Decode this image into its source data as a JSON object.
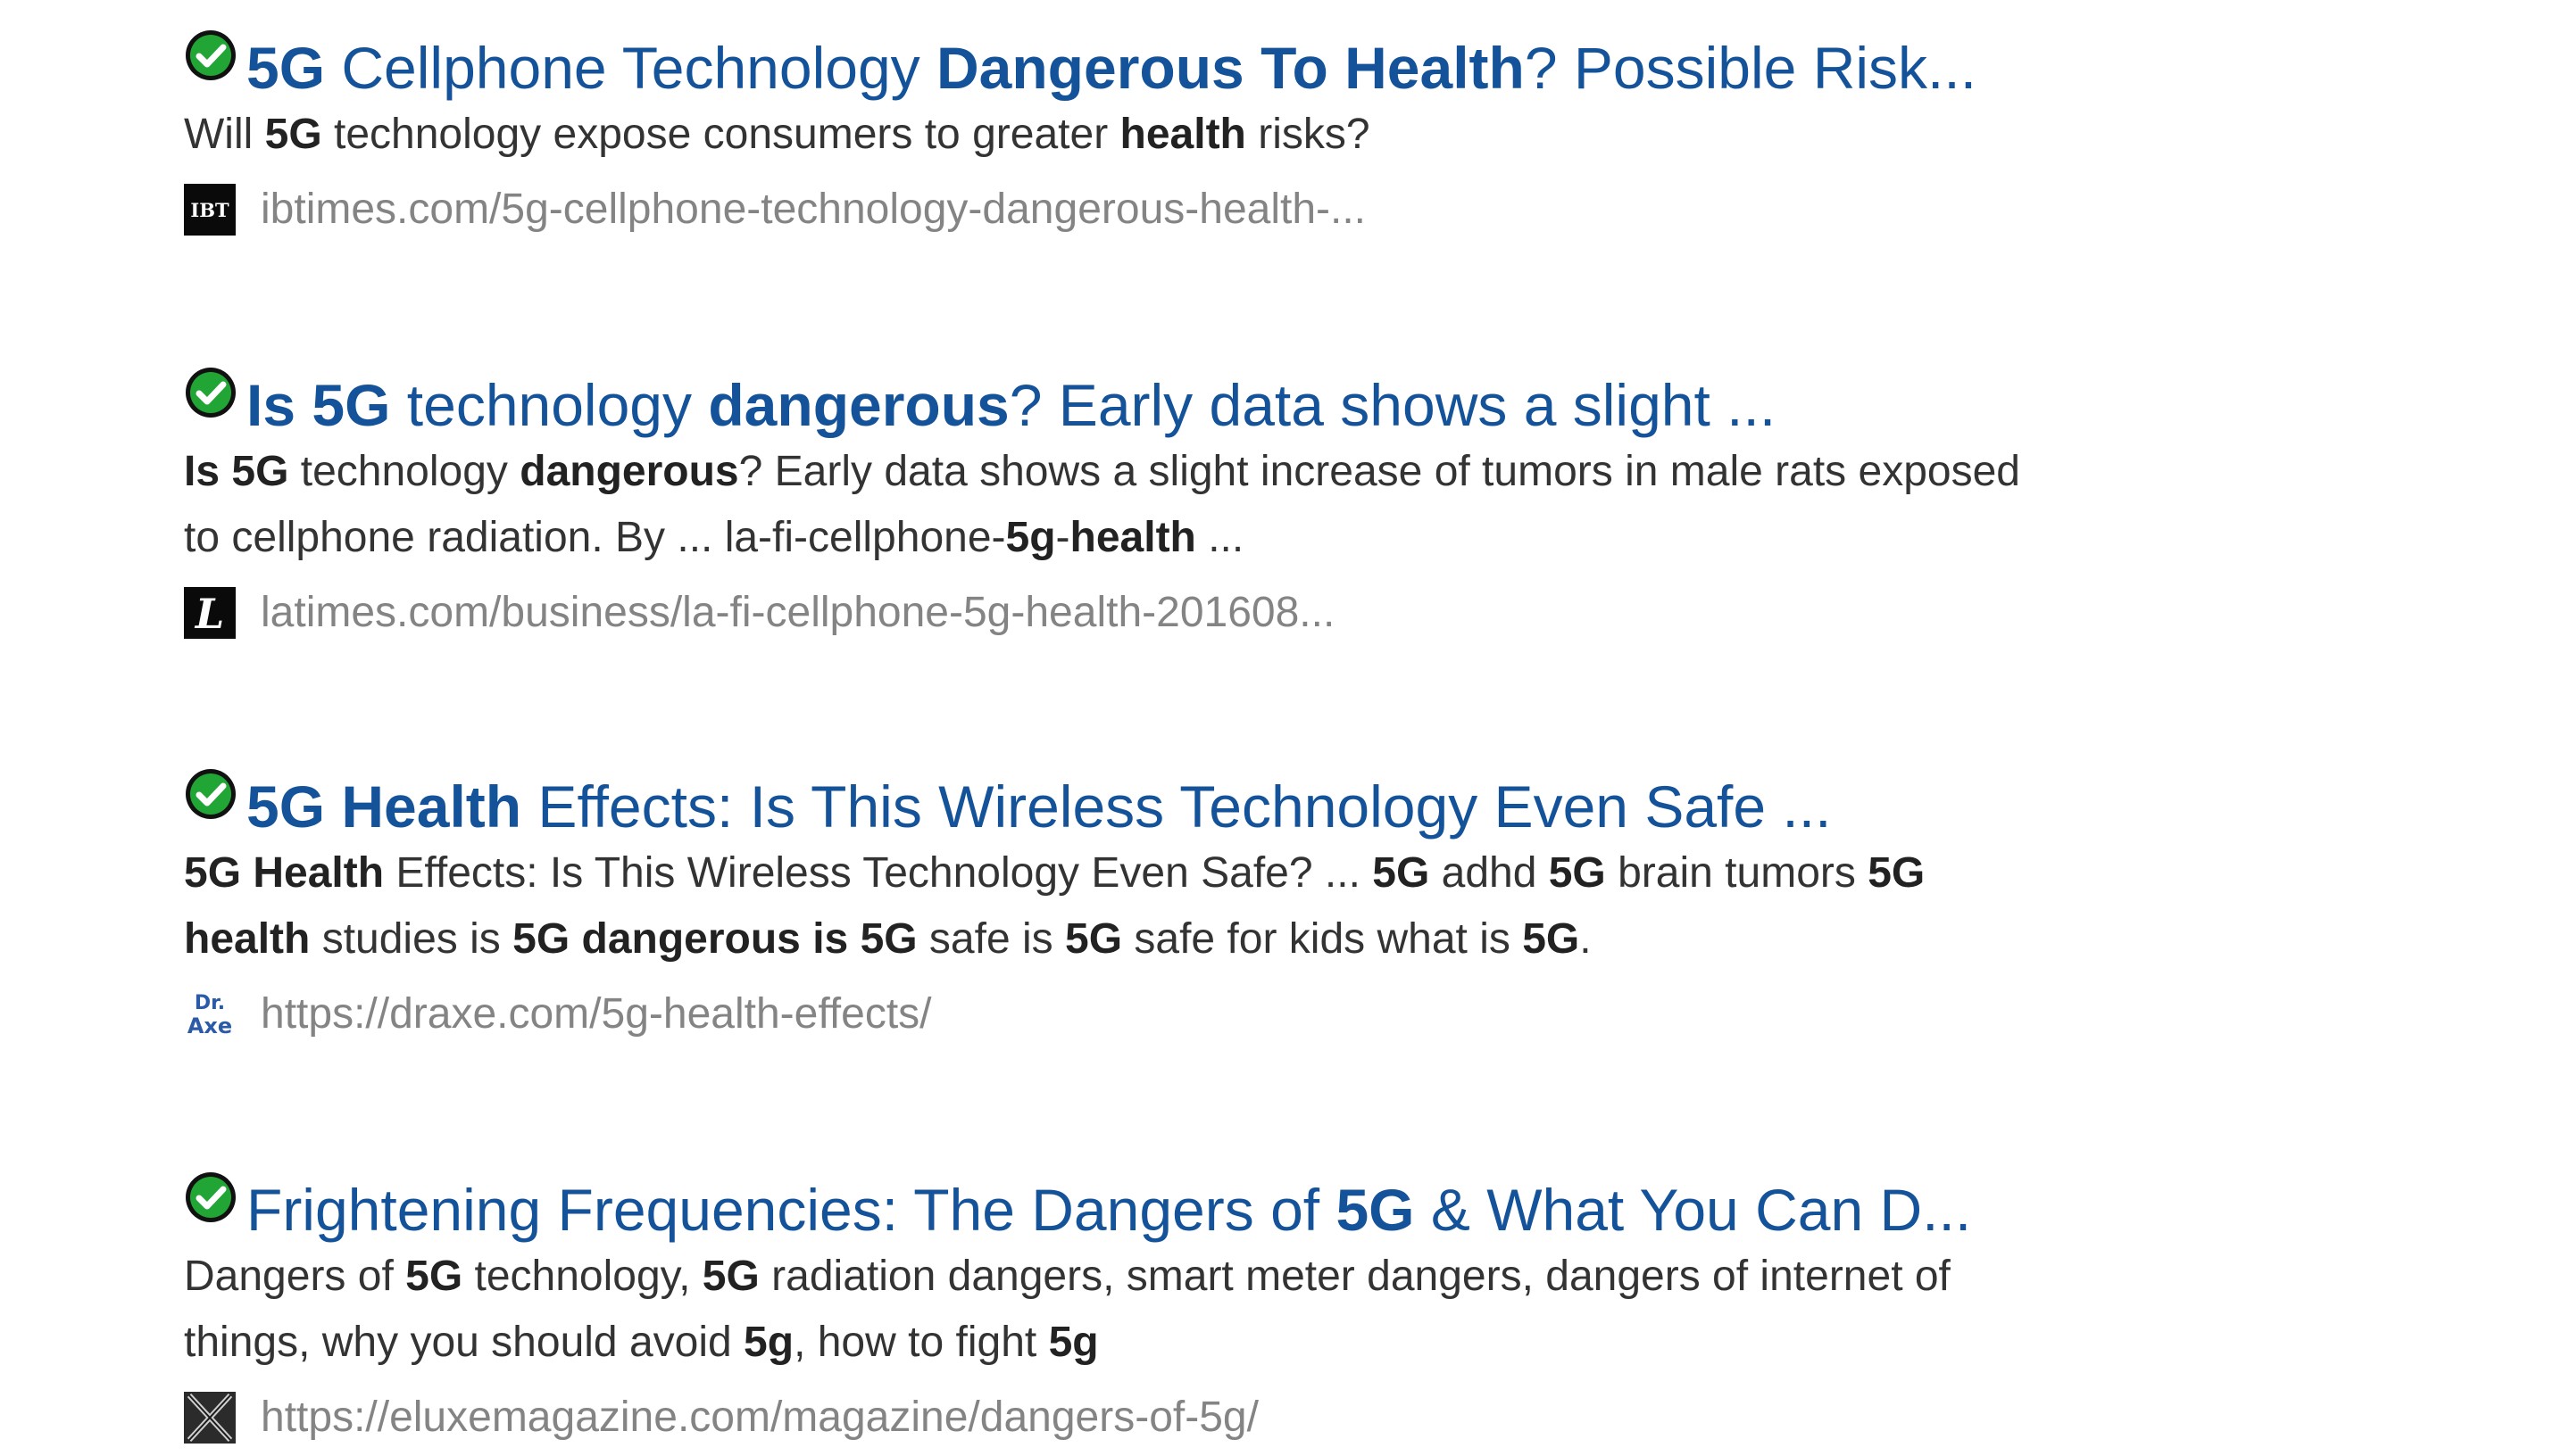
{
  "results": [
    {
      "title": [
        {
          "text": "5G",
          "bold": true
        },
        {
          "text": " Cellphone Technology ",
          "bold": false
        },
        {
          "text": "Dangerous To Health",
          "bold": true
        },
        {
          "text": "? Possible Risk...",
          "bold": false
        }
      ],
      "snippet": [
        {
          "text": "Will ",
          "bold": false
        },
        {
          "text": "5G",
          "bold": true
        },
        {
          "text": " technology expose consumers to greater ",
          "bold": false
        },
        {
          "text": "health",
          "bold": true
        },
        {
          "text": " risks?",
          "bold": false
        }
      ],
      "url": "ibtimes.com/5g-cellphone-technology-dangerous-health-...",
      "favicon_icon": "ibt-favicon-icon",
      "favicon_text": "IBT"
    },
    {
      "title": [
        {
          "text": "Is 5G",
          "bold": true
        },
        {
          "text": " technology ",
          "bold": false
        },
        {
          "text": "dangerous",
          "bold": true
        },
        {
          "text": "? Early data shows a slight ...",
          "bold": false
        }
      ],
      "snippet": [
        {
          "text": "Is 5G",
          "bold": true
        },
        {
          "text": " technology ",
          "bold": false
        },
        {
          "text": "dangerous",
          "bold": true
        },
        {
          "text": "? Early data shows a slight increase of tumors in male rats exposed to cellphone radiation. By ... la-fi-cellphone-",
          "bold": false
        },
        {
          "text": "5g",
          "bold": true
        },
        {
          "text": "-",
          "bold": false
        },
        {
          "text": "health",
          "bold": true
        },
        {
          "text": " ...",
          "bold": false
        }
      ],
      "url": "latimes.com/business/la-fi-cellphone-5g-health-201608...",
      "favicon_icon": "latimes-favicon-icon",
      "favicon_text": "L"
    },
    {
      "title": [
        {
          "text": "5G Health",
          "bold": true
        },
        {
          "text": " Effects: Is This Wireless Technology Even Safe ...",
          "bold": false
        }
      ],
      "snippet": [
        {
          "text": "5G Health",
          "bold": true
        },
        {
          "text": " Effects: Is This Wireless Technology Even Safe? ... ",
          "bold": false
        },
        {
          "text": "5G",
          "bold": true
        },
        {
          "text": " adhd ",
          "bold": false
        },
        {
          "text": "5G",
          "bold": true
        },
        {
          "text": " brain tumors ",
          "bold": false
        },
        {
          "text": "5G health",
          "bold": true
        },
        {
          "text": " studies is ",
          "bold": false
        },
        {
          "text": "5G dangerous is 5G",
          "bold": true
        },
        {
          "text": " safe is ",
          "bold": false
        },
        {
          "text": "5G",
          "bold": true
        },
        {
          "text": " safe for kids what is ",
          "bold": false
        },
        {
          "text": "5G",
          "bold": true
        },
        {
          "text": ".",
          "bold": false
        }
      ],
      "url": "https://draxe.com/5g-health-effects/",
      "favicon_icon": "draxe-favicon-icon",
      "favicon_text": "Dr.",
      "favicon_text2": "Axe"
    },
    {
      "title": [
        {
          "text": "Frightening Frequencies: The Dangers of ",
          "bold": false
        },
        {
          "text": "5G",
          "bold": true
        },
        {
          "text": " & What You Can D...",
          "bold": false
        }
      ],
      "snippet": [
        {
          "text": "Dangers of ",
          "bold": false
        },
        {
          "text": "5G",
          "bold": true
        },
        {
          "text": " technology, ",
          "bold": false
        },
        {
          "text": "5G",
          "bold": true
        },
        {
          "text": " radiation dangers, smart meter dangers, dangers of internet of things, why you should avoid ",
          "bold": false
        },
        {
          "text": "5g",
          "bold": true
        },
        {
          "text": ", how to fight ",
          "bold": false
        },
        {
          "text": "5g",
          "bold": true
        }
      ],
      "url": "https://eluxemagazine.com/magazine/dangers-of-5g/",
      "favicon_icon": "eluxe-favicon-icon",
      "favicon_text": ""
    }
  ],
  "colors": {
    "title": "#14539a",
    "snippet": "#333333",
    "url": "#848484",
    "check": "#1aa323"
  }
}
